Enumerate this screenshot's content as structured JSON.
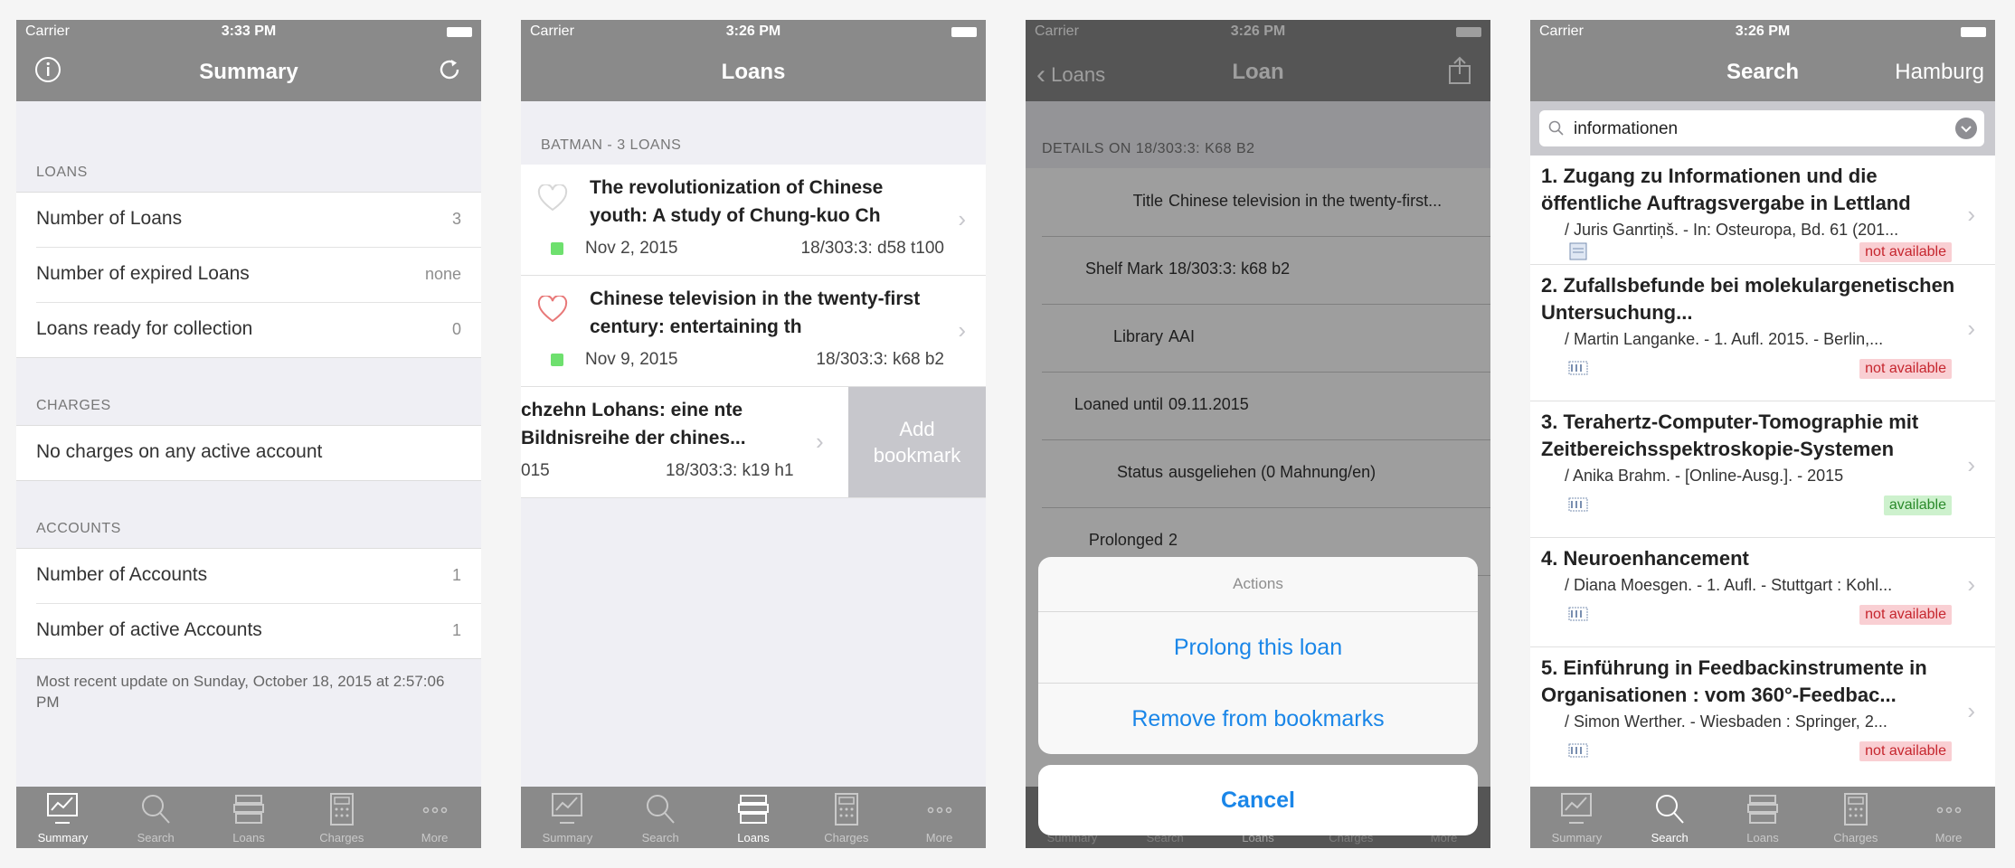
{
  "statusbar": {
    "carrier": "Carrier"
  },
  "tabs": [
    "Summary",
    "Search",
    "Loans",
    "Charges",
    "More"
  ],
  "screen1": {
    "time": "3:33 PM",
    "title": "Summary",
    "loans_header": "LOANS",
    "loans": [
      {
        "label": "Number of Loans",
        "value": "3"
      },
      {
        "label": "Number of expired Loans",
        "value": "none"
      },
      {
        "label": "Loans ready for collection",
        "value": "0"
      }
    ],
    "charges_header": "CHARGES",
    "charges_text": "No charges on any active account",
    "accounts_header": "ACCOUNTS",
    "accounts": [
      {
        "label": "Number of Accounts",
        "value": "1"
      },
      {
        "label": "Number of active Accounts",
        "value": "1"
      }
    ],
    "footer": "Most recent update on Sunday, October 18, 2015 at 2:57:06 PM"
  },
  "screen2": {
    "time": "3:26 PM",
    "title": "Loans",
    "section": "BATMAN - 3 LOANS",
    "items": [
      {
        "title": "The revolutionization of Chinese youth: A study of Chung-kuo Ch",
        "date": "Nov 2, 2015",
        "shelf": "18/303:3: d58 t100"
      },
      {
        "title": "Chinese television in the twenty-first century: entertaining th",
        "date": "Nov 9, 2015",
        "shelf": "18/303:3: k68 b2"
      },
      {
        "title": "chzehn Lohans: eine nte Bildnisreihe der chines...",
        "date": "015",
        "shelf": "18/303:3: k19 h1"
      }
    ],
    "swipe_action": "Add bookmark"
  },
  "screen3": {
    "time": "3:26 PM",
    "back": "Loans",
    "title": "Loan",
    "section": "DETAILS ON 18/303:3: K68 B2",
    "details": [
      {
        "key": "Title",
        "value": "Chinese television in the twenty-first..."
      },
      {
        "key": "Shelf Mark",
        "value": "18/303:3: k68 b2"
      },
      {
        "key": "Library",
        "value": "AAI"
      },
      {
        "key": "Loaned until",
        "value": "09.11.2015"
      },
      {
        "key": "Status",
        "value": "ausgeliehen (0 Mahnung/en)"
      },
      {
        "key": "Prolonged",
        "value": "2"
      }
    ],
    "sheet_title": "Actions",
    "actions": [
      "Prolong this loan",
      "Remove from bookmarks"
    ],
    "cancel": "Cancel"
  },
  "screen4": {
    "time": "3:26 PM",
    "title": "Search",
    "right": "Hamburg",
    "query": "informationen",
    "results": [
      {
        "num": "1.",
        "title": "Zugang zu Informationen und die öffentliche Auftragsvergabe in Lettland",
        "author": "/ Juris Ganrtiņš. - In: Osteuropa, Bd. 61 (201...",
        "status": "not available"
      },
      {
        "num": "2.",
        "title": "Zufallsbefunde bei molekulargenetischen Untersuchung...",
        "author": "/ Martin Langanke. - 1. Aufl. 2015. - Berlin,...",
        "status": "not available"
      },
      {
        "num": "3.",
        "title": "Terahertz-Computer-Tomographie mit Zeitbereichsspektroskopie-Systemen",
        "author": "/ Anika Brahm. -  [Online-Ausg.]. - 2015",
        "status": "available"
      },
      {
        "num": "4.",
        "title": "Neuroenhancement",
        "author": "/ Diana Moesgen. - 1. Aufl. - Stuttgart : Kohl...",
        "status": "not available"
      },
      {
        "num": "5.",
        "title": "Einführung in Feedbackinstrumente in Organisationen : vom 360°-Feedbac...",
        "author": "/ Simon Werther. - Wiesbaden : Springer, 2...",
        "status": "not available"
      }
    ]
  },
  "colors": {
    "accent": "#1a86e8",
    "bar": "#8a8a8a",
    "heart": "#e87878",
    "dot": "#6ee06e"
  }
}
